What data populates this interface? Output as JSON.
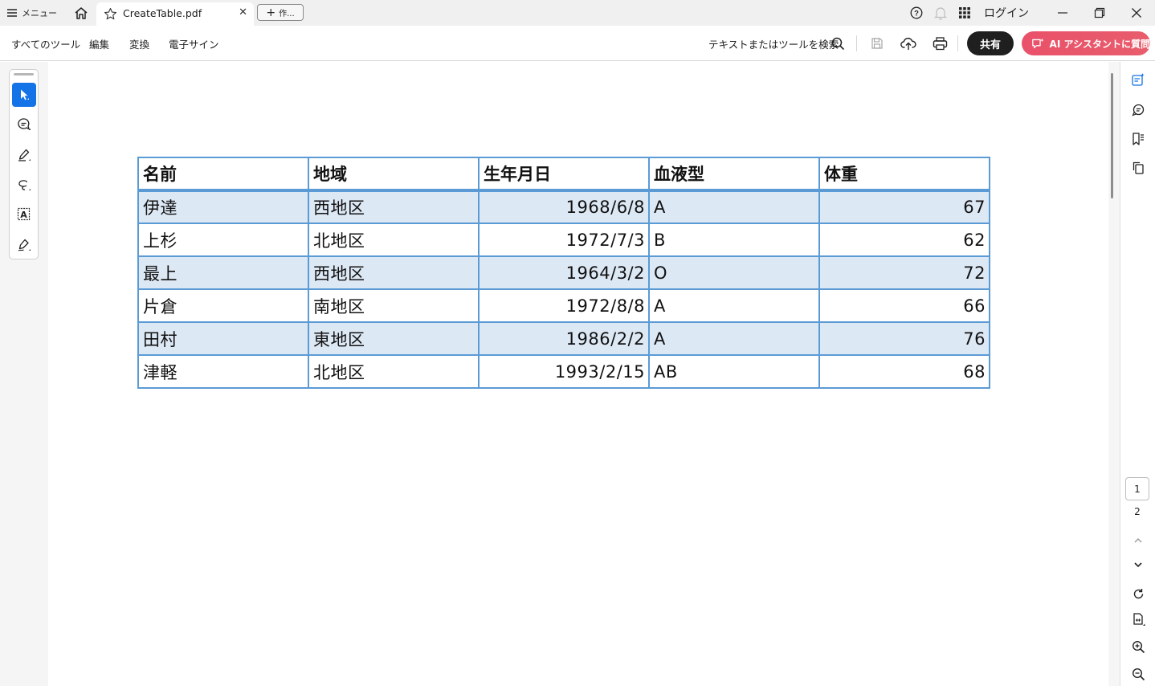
{
  "titlebar": {
    "menu_label": "メニュー",
    "tab_title": "CreateTable.pdf",
    "new_tab_label": "作...",
    "login_label": "ログイン"
  },
  "toolbar": {
    "menus": [
      "すべてのツール",
      "編集",
      "変換",
      "電子サイン"
    ],
    "search_label": "テキストまたはツールを検索",
    "share_label": "共有",
    "ai_label": "AI アシスタントに質問"
  },
  "table": {
    "headers": [
      "名前",
      "地域",
      "生年月日",
      "血液型",
      "体重"
    ],
    "rows": [
      [
        "伊達",
        "西地区",
        "1968/6/8",
        "A",
        "67"
      ],
      [
        "上杉",
        "北地区",
        "1972/7/3",
        "B",
        "62"
      ],
      [
        "最上",
        "西地区",
        "1964/3/2",
        "O",
        "72"
      ],
      [
        "片倉",
        "南地区",
        "1972/8/8",
        "A",
        "66"
      ],
      [
        "田村",
        "東地区",
        "1986/2/2",
        "A",
        "76"
      ],
      [
        "津軽",
        "北地区",
        "1993/2/15",
        "AB",
        "68"
      ]
    ]
  },
  "pagination": {
    "current_page": "1",
    "total_pages": "2"
  },
  "colors": {
    "accent": "#1473e6",
    "table_border": "#5b9bd5",
    "band_fill": "#dde8f5",
    "ai_button": "#e9516a"
  },
  "icons": {
    "left_tools": [
      "select-arrow-icon",
      "comment-icon",
      "highlight-pen-icon",
      "lasso-draw-icon",
      "text-box-icon",
      "signature-icon"
    ],
    "right_tools": [
      "ai-summary-icon",
      "comments-panel-icon",
      "bookmarks-icon",
      "copy-pages-icon"
    ]
  }
}
